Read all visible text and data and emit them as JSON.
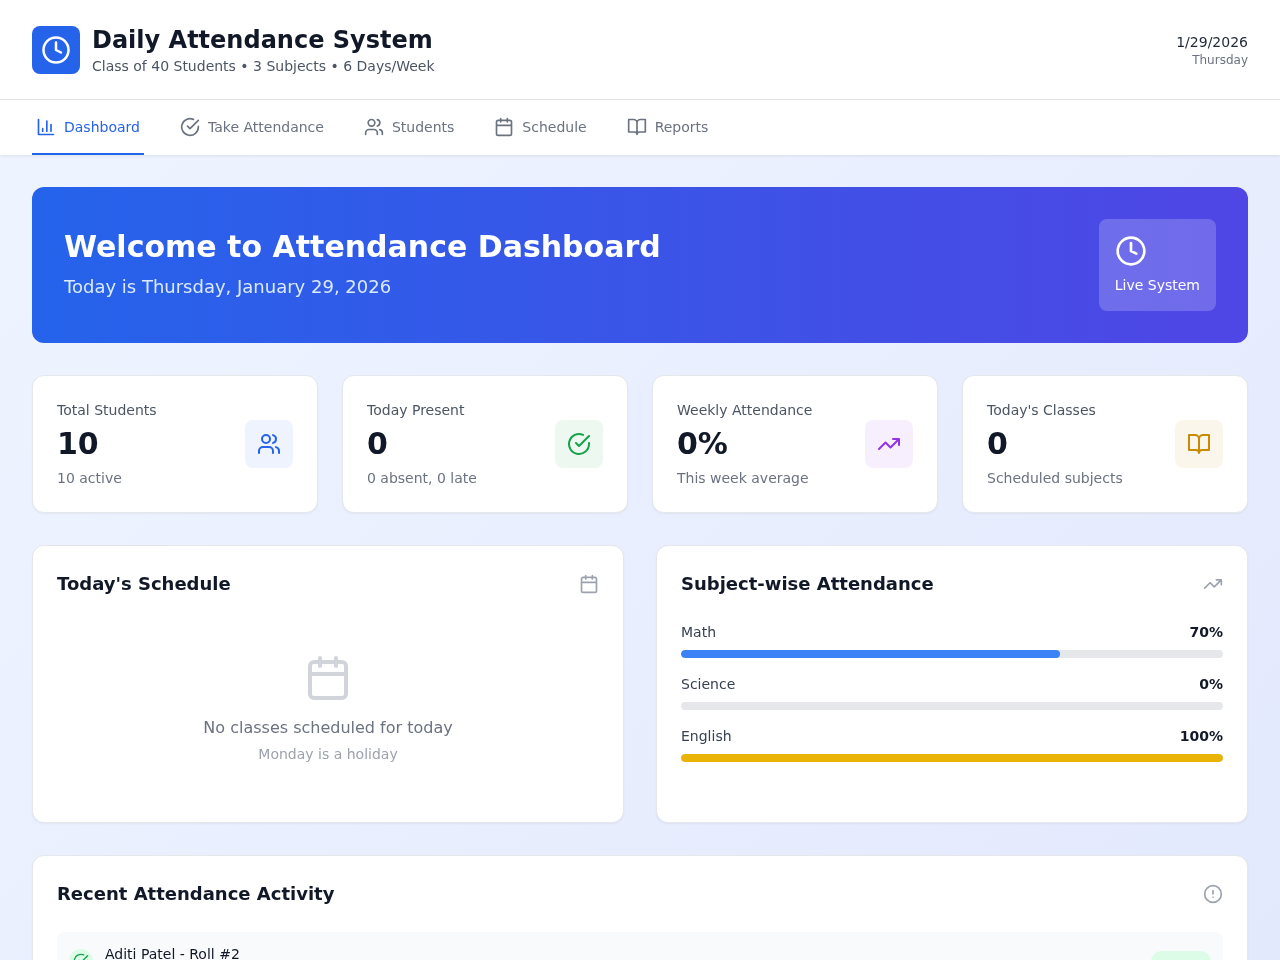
{
  "header": {
    "title": "Daily Attendance System",
    "subtitle": "Class of 40 Students • 3 Subjects • 6 Days/Week",
    "date": "1/29/2026",
    "weekday": "Thursday"
  },
  "tabs": [
    {
      "label": "Dashboard",
      "selected": true
    },
    {
      "label": "Take Attendance",
      "selected": false
    },
    {
      "label": "Students",
      "selected": false
    },
    {
      "label": "Schedule",
      "selected": false
    },
    {
      "label": "Reports",
      "selected": false
    }
  ],
  "banner": {
    "title": "Welcome to Attendance Dashboard",
    "subtitle": "Today is Thursday, January 29, 2026",
    "status_label": "Live System"
  },
  "stats": [
    {
      "label": "Total Students",
      "value": "10",
      "note": "10 active",
      "color": "#2563eb"
    },
    {
      "label": "Today Present",
      "value": "0",
      "note": "0 absent, 0 late",
      "color": "#16a34a"
    },
    {
      "label": "Weekly Attendance",
      "value": "0%",
      "note": "This week average",
      "color": "#9333ea"
    },
    {
      "label": "Today's Classes",
      "value": "0",
      "note": "Scheduled subjects",
      "color": "#ca8a04"
    }
  ],
  "schedule": {
    "title": "Today's Schedule",
    "empty_message": "No classes scheduled for today",
    "empty_note": "Monday is a holiday"
  },
  "subject_attendance": {
    "title": "Subject-wise Attendance",
    "subjects": [
      {
        "name": "Math",
        "percent": "70%",
        "level": 0.7,
        "color": "#3b82f6"
      },
      {
        "name": "Science",
        "percent": "0%"
      },
      {
        "name": "English",
        "percent": "100%",
        "level": 1,
        "color": "#eab308"
      }
    ]
  },
  "recent_activity": {
    "title": "Recent Attendance Activity",
    "records": [
      {
        "student": "Aditi Patel - Roll #2",
        "kind": "present"
      }
    ]
  }
}
